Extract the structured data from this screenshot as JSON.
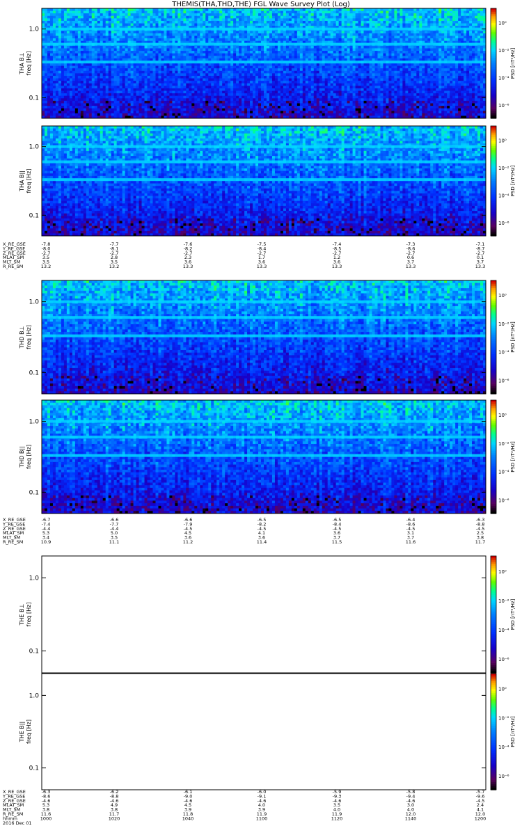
{
  "title": "THEMIS(THA,THD,THE) FGL Wave Survey Plot (Log)",
  "date_label": "2016 Dec 01",
  "time_label_name": "hhmm",
  "colorbar": {
    "label": "PSD [nT²/Hz]",
    "ticks": [
      "10⁰",
      "10⁻²",
      "10⁻⁴",
      "10⁻⁶"
    ],
    "colors": [
      "#000000",
      "#5a0060",
      "#1800c8",
      "#0030ff",
      "#0080ff",
      "#00d8ff",
      "#00ff90",
      "#60ff00",
      "#ffff00",
      "#ffa000",
      "#ff2000",
      "#d00000"
    ]
  },
  "chart_data": {
    "type": "heatmap",
    "title": "THEMIS(THA,THD,THE) FGL Wave Survey Plot (Log)",
    "y_scale": "log",
    "y_range_hz": [
      0.05,
      2.0
    ],
    "y_ticks": [
      "1.0",
      "0.1"
    ],
    "panels": [
      {
        "id": "tha-bl",
        "ylabel_top": "THA B⊥",
        "ylabel_unit": "freq [Hz]",
        "has_data": true,
        "spectral_lines_hz": [
          1.0,
          0.6,
          0.33
        ]
      },
      {
        "id": "tha-bpar",
        "ylabel_top": "THA B||",
        "ylabel_unit": "freq [Hz]",
        "has_data": true,
        "spectral_lines_hz": [
          1.0,
          0.6,
          0.33
        ]
      },
      {
        "id": "thd-bl",
        "ylabel_top": "THD B⊥",
        "ylabel_unit": "freq [Hz]",
        "has_data": true,
        "spectral_lines_hz": [
          1.0,
          0.6,
          0.33
        ]
      },
      {
        "id": "thd-bpar",
        "ylabel_top": "THD B||",
        "ylabel_unit": "freq [Hz]",
        "has_data": true,
        "spectral_lines_hz": [
          1.0,
          0.6,
          0.33
        ]
      },
      {
        "id": "the-bl",
        "ylabel_top": "THE B⊥",
        "ylabel_unit": "freq [Hz]",
        "has_data": false
      },
      {
        "id": "the-bpar",
        "ylabel_top": "THE B||",
        "ylabel_unit": "freq [Hz]",
        "has_data": false
      }
    ],
    "x_axis_times": [
      "1000",
      "1020",
      "1040",
      "1100",
      "1120",
      "1140",
      "1200"
    ],
    "ephemeris": [
      {
        "probe": "THA",
        "rows": [
          {
            "name": "X_RE_GSE",
            "values": [
              "-7.8",
              "-7.7",
              "-7.6",
              "-7.5",
              "-7.4",
              "-7.3",
              "-7.1"
            ]
          },
          {
            "name": "Y_RE_GSE",
            "values": [
              "-8.0",
              "-8.1",
              "-8.2",
              "-8.4",
              "-8.5",
              "-8.6",
              "-8.7"
            ]
          },
          {
            "name": "Z_RE_GSE",
            "values": [
              "-2.7",
              "-2.7",
              "-2.7",
              "-2.7",
              "-2.7",
              "-2.7",
              "-2.7"
            ]
          },
          {
            "name": "MLAT_SM",
            "values": [
              "3.5",
              "2.8",
              "2.3",
              "1.7",
              "1.2",
              "0.6",
              "0.1"
            ]
          },
          {
            "name": "MLT_SM",
            "values": [
              "3.5",
              "3.5",
              "3.6",
              "3.6",
              "3.6",
              "3.7",
              "3.7"
            ]
          },
          {
            "name": "R_RE_SM",
            "values": [
              "13.2",
              "13.2",
              "13.3",
              "13.3",
              "13.3",
              "13.3",
              "13.3"
            ]
          }
        ]
      },
      {
        "probe": "THD",
        "rows": [
          {
            "name": "X_RE_GSE",
            "values": [
              "-6.7",
              "-6.6",
              "-6.6",
              "-6.5",
              "-6.5",
              "-6.4",
              "-6.3"
            ]
          },
          {
            "name": "Y_RE_GSE",
            "values": [
              "-7.4",
              "-7.7",
              "-7.9",
              "-8.2",
              "-8.4",
              "-8.6",
              "-8.8"
            ]
          },
          {
            "name": "Z_RE_GSE",
            "values": [
              "-4.4",
              "-4.4",
              "-4.5",
              "-4.5",
              "-4.5",
              "-4.5",
              "-4.5"
            ]
          },
          {
            "name": "MLAT_SM",
            "values": [
              "5.3",
              "5.0",
              "4.5",
              "4.1",
              "3.6",
              "3.1",
              "2.5"
            ]
          },
          {
            "name": "MLT_SM",
            "values": [
              "3.4",
              "3.5",
              "3.6",
              "3.6",
              "3.7",
              "3.7",
              "3.8"
            ]
          },
          {
            "name": "R_RE_SM",
            "values": [
              "10.9",
              "11.1",
              "11.2",
              "11.4",
              "11.5",
              "11.6",
              "11.7"
            ]
          }
        ]
      },
      {
        "probe": "THE",
        "rows": [
          {
            "name": "X_RE_GSE",
            "values": [
              "-6.3",
              "-6.2",
              "-6.1",
              "-6.0",
              "-5.9",
              "-5.8",
              "-5.7"
            ]
          },
          {
            "name": "Y_RE_GSE",
            "values": [
              "-8.6",
              "-8.8",
              "-9.0",
              "-9.1",
              "-9.3",
              "-9.4",
              "-9.6"
            ]
          },
          {
            "name": "Z_RE_GSE",
            "values": [
              "-4.6",
              "-4.6",
              "-4.6",
              "-4.6",
              "-4.6",
              "-4.6",
              "-4.5"
            ]
          },
          {
            "name": "MLAT_SM",
            "values": [
              "5.3",
              "4.9",
              "4.5",
              "4.0",
              "3.5",
              "3.0",
              "2.4"
            ]
          },
          {
            "name": "MLT_SM",
            "values": [
              "3.8",
              "3.8",
              "3.9",
              "3.9",
              "4.0",
              "4.0",
              "4.1"
            ]
          },
          {
            "name": "R_RE_SM",
            "values": [
              "11.6",
              "11.7",
              "11.8",
              "11.9",
              "11.9",
              "12.0",
              "12.0"
            ]
          }
        ]
      }
    ]
  }
}
